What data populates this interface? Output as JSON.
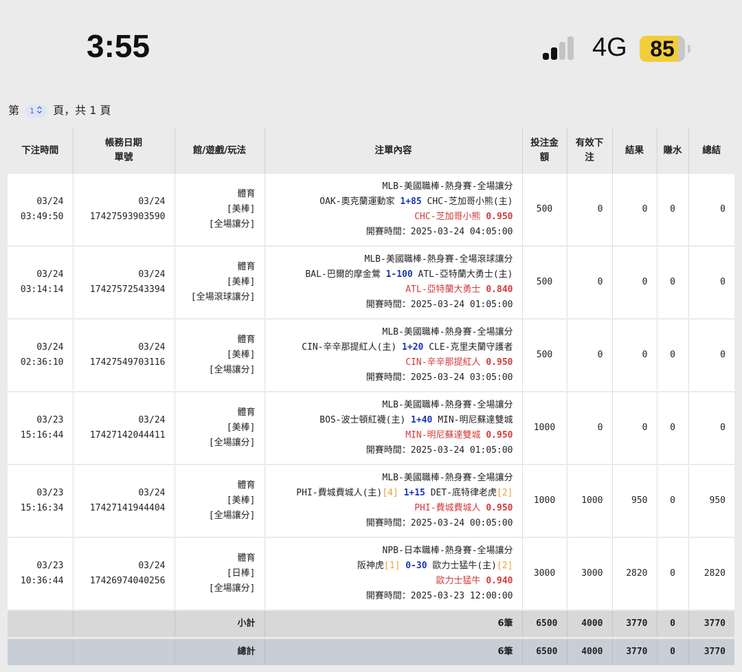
{
  "status_bar": {
    "time": "3:55",
    "network": "4G",
    "battery_level": "85",
    "battery_fraction": 0.85,
    "battery_color": "#f2cd3a",
    "signal_icon": "cellular-signal-icon",
    "signal_bars_active": 2,
    "signal_bars_total": 4
  },
  "pager": {
    "prefix": "第",
    "current_page": "1",
    "page_select_icon": "chevron-updown-icon",
    "suffix": "頁，共 1 頁"
  },
  "table": {
    "headers": {
      "bet_time": "下注時間",
      "account_date_1": "帳務日期",
      "account_date_2": "單號",
      "venue": "館/遊戲/玩法",
      "content": "注單內容",
      "amount_1": "投注金",
      "amount_2": "額",
      "valid_1": "有效下",
      "valid_2": "注",
      "result": "結果",
      "rebate": "賺水",
      "total": "總結"
    },
    "rows": [
      {
        "bet_date": "03/24",
        "bet_clock": "03:49:50",
        "acc_date": "03/24",
        "ticket_no": "17427593903590",
        "venue": "體育",
        "game": "[美棒]",
        "play": "[全場讓分]",
        "league": "MLB-美國職棒-熱身賽-全場讓分",
        "team_a": "OAK-奧克蘭運動家",
        "team_a_tag": "",
        "handicap": "1+85",
        "team_b": "CHC-芝加哥小熊(主)",
        "team_b_tag": "",
        "pick": "CHC-芝加哥小熊",
        "odds": "0.950",
        "start_time": "開賽時間：2025-03-24 04:05:00",
        "amount": "500",
        "valid": "0",
        "result": "0",
        "rebate": "0",
        "total": "0"
      },
      {
        "bet_date": "03/24",
        "bet_clock": "03:14:14",
        "acc_date": "03/24",
        "ticket_no": "17427572543394",
        "venue": "體育",
        "game": "[美棒]",
        "play": "[全場滾球讓分]",
        "league": "MLB-美國職棒-熱身賽-全場滾球讓分",
        "team_a": "BAL-巴爾的摩金鶯",
        "team_a_tag": "",
        "handicap": "1-100",
        "team_b": "ATL-亞特蘭大勇士(主)",
        "team_b_tag": "",
        "pick": "ATL-亞特蘭大勇士",
        "odds": "0.840",
        "start_time": "開賽時間：2025-03-24 01:05:00",
        "amount": "500",
        "valid": "0",
        "result": "0",
        "rebate": "0",
        "total": "0"
      },
      {
        "bet_date": "03/24",
        "bet_clock": "02:36:10",
        "acc_date": "03/24",
        "ticket_no": "17427549703116",
        "venue": "體育",
        "game": "[美棒]",
        "play": "[全場讓分]",
        "league": "MLB-美國職棒-熱身賽-全場讓分",
        "team_a": "CIN-辛辛那提紅人(主)",
        "team_a_tag": "",
        "handicap": "1+20",
        "team_b": "CLE-克里夫蘭守護者",
        "team_b_tag": "",
        "pick": "CIN-辛辛那提紅人",
        "odds": "0.950",
        "start_time": "開賽時間：2025-03-24 03:05:00",
        "amount": "500",
        "valid": "0",
        "result": "0",
        "rebate": "0",
        "total": "0"
      },
      {
        "bet_date": "03/23",
        "bet_clock": "15:16:44",
        "acc_date": "03/24",
        "ticket_no": "17427142044411",
        "venue": "體育",
        "game": "[美棒]",
        "play": "[全場讓分]",
        "league": "MLB-美國職棒-熱身賽-全場讓分",
        "team_a": "BOS-波士頓紅襪(主)",
        "team_a_tag": "",
        "handicap": "1+40",
        "team_b": "MIN-明尼蘇達雙城",
        "team_b_tag": "",
        "pick": "MIN-明尼蘇達雙城",
        "odds": "0.950",
        "start_time": "開賽時間：2025-03-24 01:05:00",
        "amount": "1000",
        "valid": "0",
        "result": "0",
        "rebate": "0",
        "total": "0"
      },
      {
        "bet_date": "03/23",
        "bet_clock": "15:16:34",
        "acc_date": "03/24",
        "ticket_no": "17427141944404",
        "venue": "體育",
        "game": "[美棒]",
        "play": "[全場讓分]",
        "league": "MLB-美國職棒-熱身賽-全場讓分",
        "team_a": "PHI-費城費城人(主)",
        "team_a_tag": "[4]",
        "handicap": "1+15",
        "team_b": "DET-底特律老虎",
        "team_b_tag": "[2]",
        "pick": "PHI-費城費城人",
        "odds": "0.950",
        "start_time": "開賽時間：2025-03-24 00:05:00",
        "amount": "1000",
        "valid": "1000",
        "result": "950",
        "rebate": "0",
        "total": "950"
      },
      {
        "bet_date": "03/23",
        "bet_clock": "10:36:44",
        "acc_date": "03/24",
        "ticket_no": "17426974040256",
        "venue": "體育",
        "game": "[日棒]",
        "play": "[全場讓分]",
        "league": "NPB-日本職棒-熱身賽-全場讓分",
        "team_a": "阪神虎",
        "team_a_tag": "[1]",
        "handicap": "0-30",
        "team_b": "歐力士猛牛(主)",
        "team_b_tag": "[2]",
        "pick": "歐力士猛牛",
        "odds": "0.940",
        "start_time": "開賽時間：2025-03-23 12:00:00",
        "amount": "3000",
        "valid": "3000",
        "result": "2820",
        "rebate": "0",
        "total": "2820"
      }
    ],
    "subtotal": {
      "label": "小計",
      "count": "6筆",
      "amount": "6500",
      "valid": "4000",
      "result": "3770",
      "rebate": "0",
      "total": "3770"
    },
    "grand_total": {
      "label": "總計",
      "count": "6筆",
      "amount": "6500",
      "valid": "4000",
      "result": "3770",
      "rebate": "0",
      "total": "3770"
    }
  },
  "colors": {
    "win_green": "#3a9a2c",
    "pick_red": "#d23a3a",
    "handicap_blue": "#1a35b3",
    "tag_orange": "#e6a33a"
  }
}
